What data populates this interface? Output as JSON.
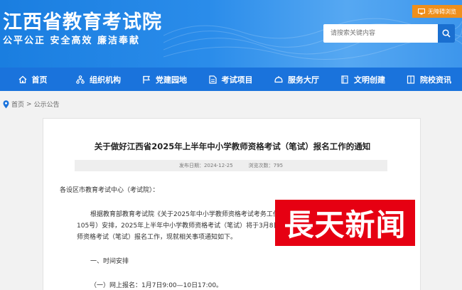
{
  "header": {
    "site_title": "江西省教育考试院",
    "slogan": "公平公正  安全高效  廉洁奉献",
    "accessibility_label": "无障碍浏览",
    "search_placeholder": "请搜索关键内容"
  },
  "nav": {
    "items": [
      {
        "label": "首页",
        "icon": "home-icon"
      },
      {
        "label": "组织机构",
        "icon": "org-chart-icon"
      },
      {
        "label": "党建园地",
        "icon": "party-flag-icon"
      },
      {
        "label": "考试项目",
        "icon": "document-icon"
      },
      {
        "label": "服务大厅",
        "icon": "service-icon"
      },
      {
        "label": "文明创建",
        "icon": "book-icon"
      },
      {
        "label": "院校资讯",
        "icon": "news-icon"
      }
    ]
  },
  "breadcrumb": {
    "home": "首页",
    "separator": ">",
    "current": "公示公告"
  },
  "article": {
    "title": "关于做好江西省2025年上半年中小学教师资格考试（笔试）报名工作的通知",
    "publish_label": "发布日期：",
    "publish_date": "2024-12-25",
    "views_label": "浏览次数：",
    "views": "795",
    "salutation": "各设区市教育考试中心（考试院）：",
    "body_line1": "根据教育部教育考试院《关于2025年中小学教师资格考试考务工作",
    "body_line2": "105号）安排，2025年上半年中小学教师资格考试（笔试）将于3月8日",
    "body_line3": "师资格考试（笔试）报名工作，现就相关事项通知如下。",
    "section1_heading": "一、时间安排",
    "section1_item1": "（一）网上报名：1月7日9:00—10日17:00。"
  },
  "watermark": {
    "text": "長天新闻"
  },
  "colors": {
    "header_blue": "#1a7ee0",
    "nav_blue": "#1a73dc",
    "accent_orange": "#ef8f1b",
    "watermark_red": "#e60012"
  }
}
